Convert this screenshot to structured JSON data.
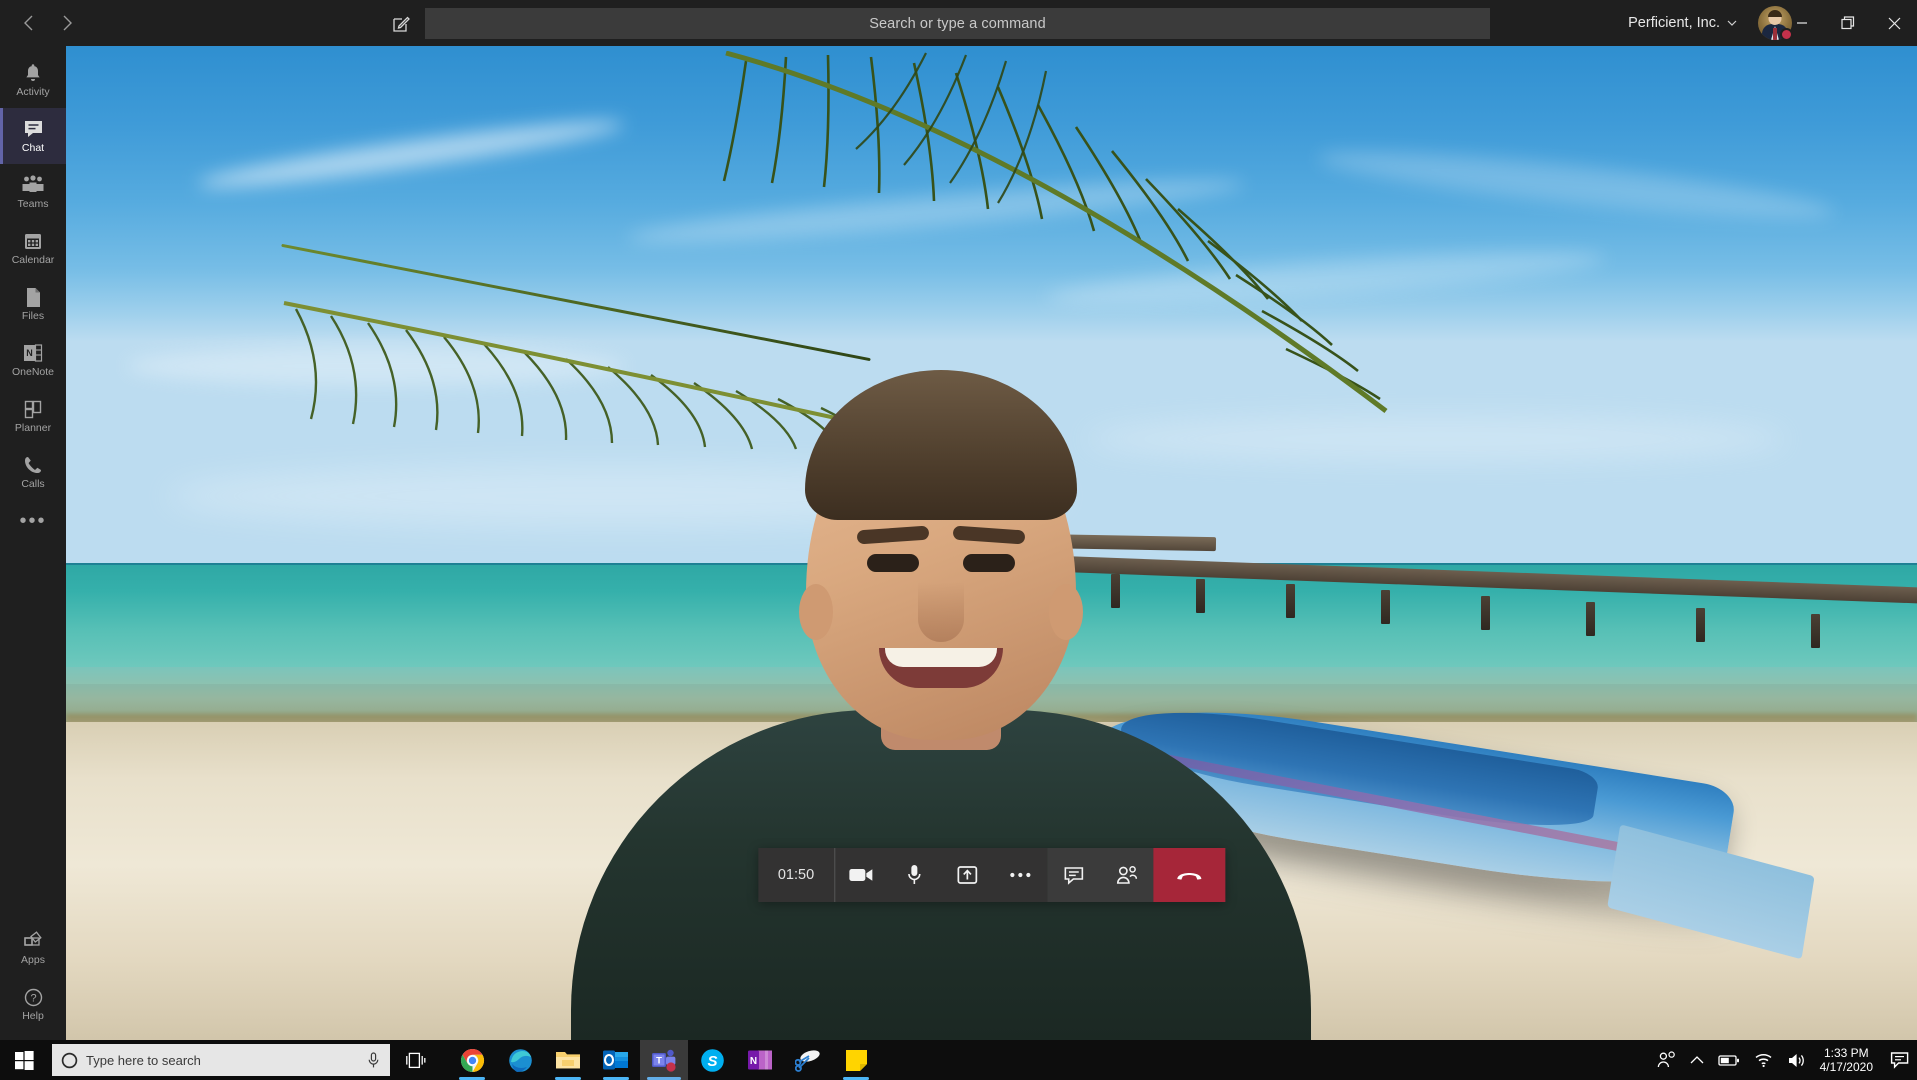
{
  "app": {
    "name": "Microsoft Teams"
  },
  "titlebar": {
    "back_icon": "chevron-left-icon",
    "forward_icon": "chevron-right-icon",
    "compose_icon": "compose-pencil-icon",
    "search_placeholder": "Search or type a command",
    "search_value": "",
    "org_name": "Perficient, Inc.",
    "org_chevron": "chevron-down-icon",
    "avatar_name": "user-avatar",
    "presence_status": "busy",
    "presence_color": "#c4314b",
    "minimize_label": "Minimize",
    "maximize_label": "Restore",
    "close_label": "Close"
  },
  "rail": {
    "items": [
      {
        "label": "Activity",
        "icon": "bell-icon",
        "active": false
      },
      {
        "label": "Chat",
        "icon": "chat-bubble-icon",
        "active": true
      },
      {
        "label": "Teams",
        "icon": "teams-people-icon",
        "active": false
      },
      {
        "label": "Calendar",
        "icon": "calendar-icon",
        "active": false
      },
      {
        "label": "Files",
        "icon": "files-page-icon",
        "active": false
      },
      {
        "label": "OneNote",
        "icon": "onenote-icon",
        "active": false
      },
      {
        "label": "Planner",
        "icon": "planner-icon",
        "active": false
      },
      {
        "label": "Calls",
        "icon": "phone-icon",
        "active": false
      }
    ],
    "more_label": "•••",
    "bottom_items": [
      {
        "label": "Apps",
        "icon": "apps-grid-icon"
      },
      {
        "label": "Help",
        "icon": "help-question-icon"
      }
    ],
    "active_accent": "#6264a7"
  },
  "stage": {
    "scene_description": "Video call self view with beach background effect: blue sky, palm fronds, turquoise sea, wooden pier, white sand and a blue boat",
    "participant_label": "self-video-feed"
  },
  "callbar": {
    "timer": "01:50",
    "buttons": [
      {
        "name": "camera-button",
        "icon": "camera-icon",
        "label": "Turn camera off"
      },
      {
        "name": "mic-button",
        "icon": "microphone-icon",
        "label": "Mute"
      },
      {
        "name": "share-button",
        "icon": "share-screen-icon",
        "label": "Share"
      },
      {
        "name": "more-button",
        "icon": "more-options-icon",
        "label": "More actions"
      },
      {
        "name": "chat-button",
        "icon": "chat-bubble-icon",
        "label": "Show conversation"
      },
      {
        "name": "participants-button",
        "icon": "people-icon",
        "label": "Show participants"
      }
    ],
    "hangup": {
      "name": "hangup-button",
      "icon": "phone-hangup-icon",
      "label": "Hang up",
      "color": "#a62639"
    }
  },
  "taskbar": {
    "start_label": "Start",
    "search_placeholder": "Type here to search",
    "cortana_icon": "cortana-circle-icon",
    "mic_icon": "microphone-icon",
    "taskview_label": "Task View",
    "apps": [
      {
        "name": "chrome",
        "label": "Google Chrome",
        "running": true,
        "active": false
      },
      {
        "name": "edge",
        "label": "Microsoft Edge",
        "running": false,
        "active": false
      },
      {
        "name": "explorer",
        "label": "File Explorer",
        "running": true,
        "active": false
      },
      {
        "name": "outlook",
        "label": "Outlook",
        "running": true,
        "active": false
      },
      {
        "name": "teams",
        "label": "Microsoft Teams",
        "running": true,
        "active": true
      },
      {
        "name": "skype",
        "label": "Skype",
        "running": false,
        "active": false
      },
      {
        "name": "onenote",
        "label": "OneNote",
        "running": false,
        "active": false
      },
      {
        "name": "snip",
        "label": "Snip & Sketch",
        "running": false,
        "active": false
      },
      {
        "name": "sticky",
        "label": "Sticky Notes",
        "running": true,
        "active": false
      }
    ],
    "tray": {
      "meet_now_icon": "meet-now-person-icon",
      "show_hidden_icon": "chevron-up-icon",
      "battery_icon": "battery-icon",
      "network_icon": "wifi-icon",
      "volume_icon": "volume-icon",
      "action_center_icon": "action-center-icon",
      "time": "1:33 PM",
      "date": "4/17/2020"
    }
  }
}
